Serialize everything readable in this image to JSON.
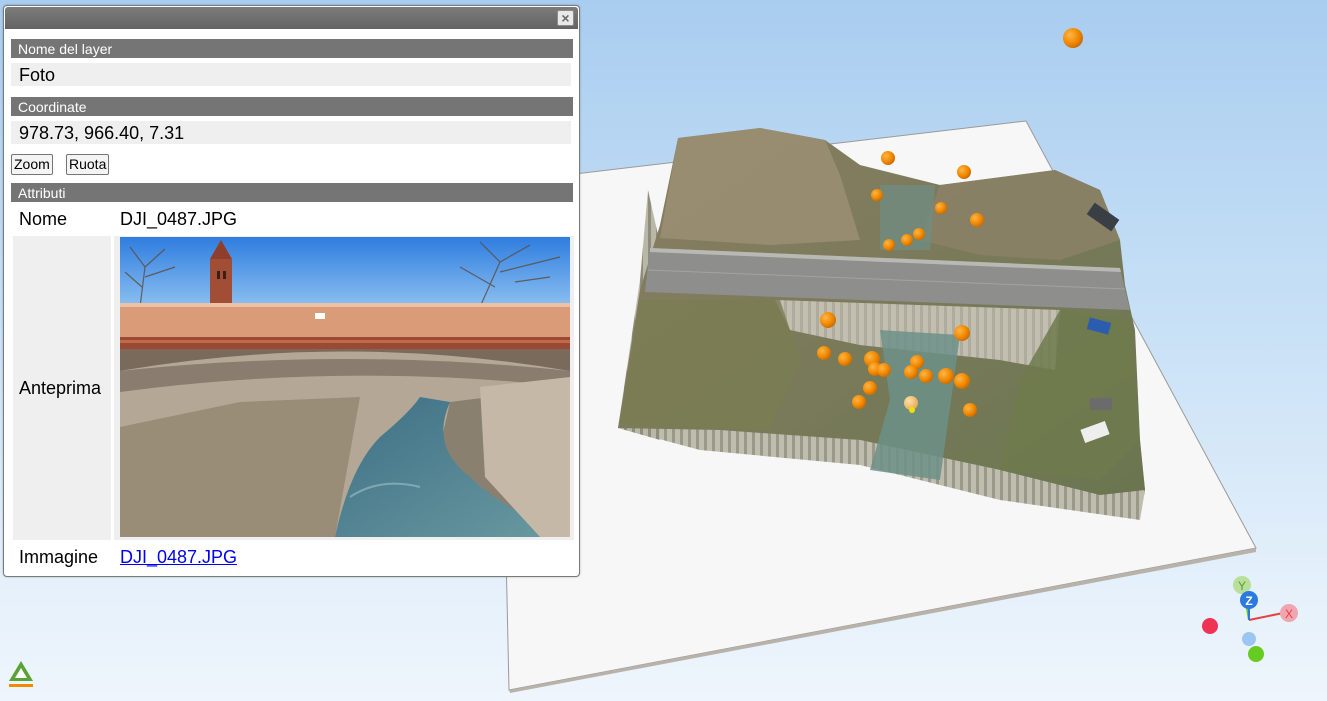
{
  "panel": {
    "layer_header": "Nome del layer",
    "layer_name": "Foto",
    "coord_header": "Coordinate",
    "coordinates": "978.73, 966.40, 7.31",
    "zoom_label": "Zoom",
    "rotate_label": "Ruota",
    "attributes_header": "Attributi",
    "name_label": "Nome",
    "name_value": "DJI_0487.JPG",
    "preview_label": "Anteprima",
    "image_label": "Immagine",
    "image_link": "DJI_0487.JPG",
    "close_icon": "close-icon"
  },
  "viewer": {
    "marker_color": "#f28a00",
    "selected_marker_color": "#f5c46a",
    "axis_colors": {
      "x": "#e84040",
      "y": "#6cc33a",
      "z": "#2a7ae0"
    },
    "axis_labels": {
      "x": "X",
      "y": "Y",
      "z": "Z"
    }
  }
}
